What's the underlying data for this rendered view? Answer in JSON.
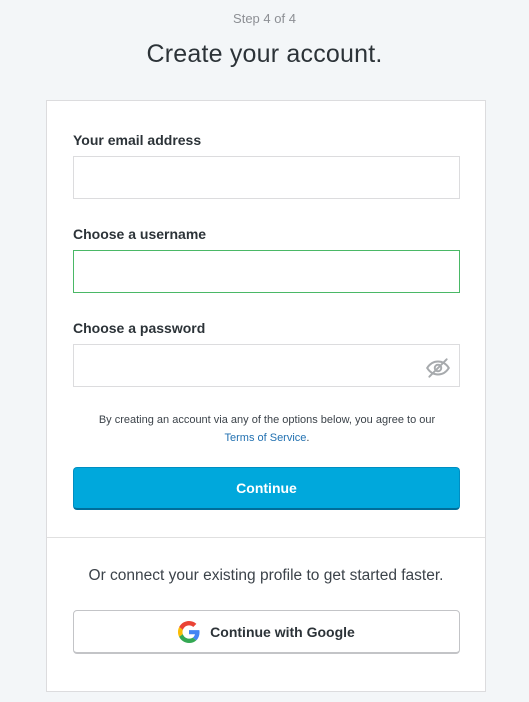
{
  "header": {
    "step": "Step 4 of 4",
    "title": "Create your account."
  },
  "form": {
    "email_label": "Your email address",
    "email_value": "",
    "username_label": "Choose a username",
    "username_value": "",
    "password_label": "Choose a password",
    "password_value": "",
    "terms_text": "By creating an account via any of the options below, you agree to our",
    "terms_link": "Terms of Service",
    "terms_suffix": ".",
    "continue_label": "Continue"
  },
  "social": {
    "prompt": "Or connect your existing profile to get started faster.",
    "google_label": "Continue with Google"
  },
  "icons": {
    "password_toggle": "eye-slash-icon",
    "google": "google-logo-icon"
  },
  "colors": {
    "primary": "#00a8dc",
    "focus_border": "#4ab866",
    "link": "#2271b1",
    "background": "#f3f6f8"
  }
}
